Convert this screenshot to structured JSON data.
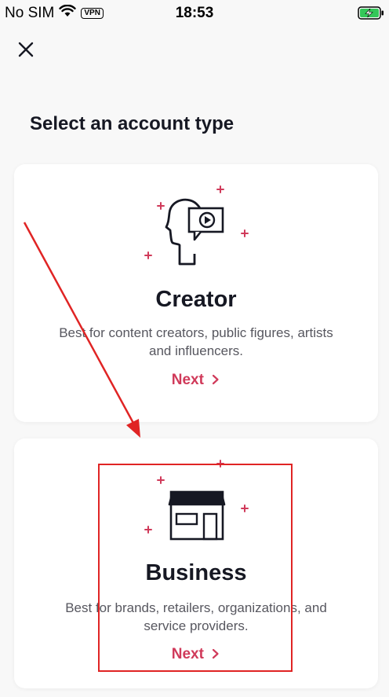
{
  "status_bar": {
    "carrier": "No SIM",
    "vpn": "VPN",
    "time": "18:53",
    "icons": [
      "wifi-icon",
      "vpn-badge",
      "battery-charging-icon"
    ]
  },
  "header": {
    "close_icon": "close-icon",
    "title": "Select an account type"
  },
  "options": [
    {
      "icon": "creator-head-video-icon",
      "title": "Creator",
      "description": "Best for content creators, public figures, artists and influencers.",
      "next_label": "Next"
    },
    {
      "icon": "storefront-icon",
      "title": "Business",
      "description": "Best for brands, retailers, organizations, and service providers.",
      "next_label": "Next"
    }
  ],
  "colors": {
    "accent": "#d03a5a",
    "annotation": "#e02424",
    "background": "#f8f8f8",
    "card": "#ffffff"
  }
}
